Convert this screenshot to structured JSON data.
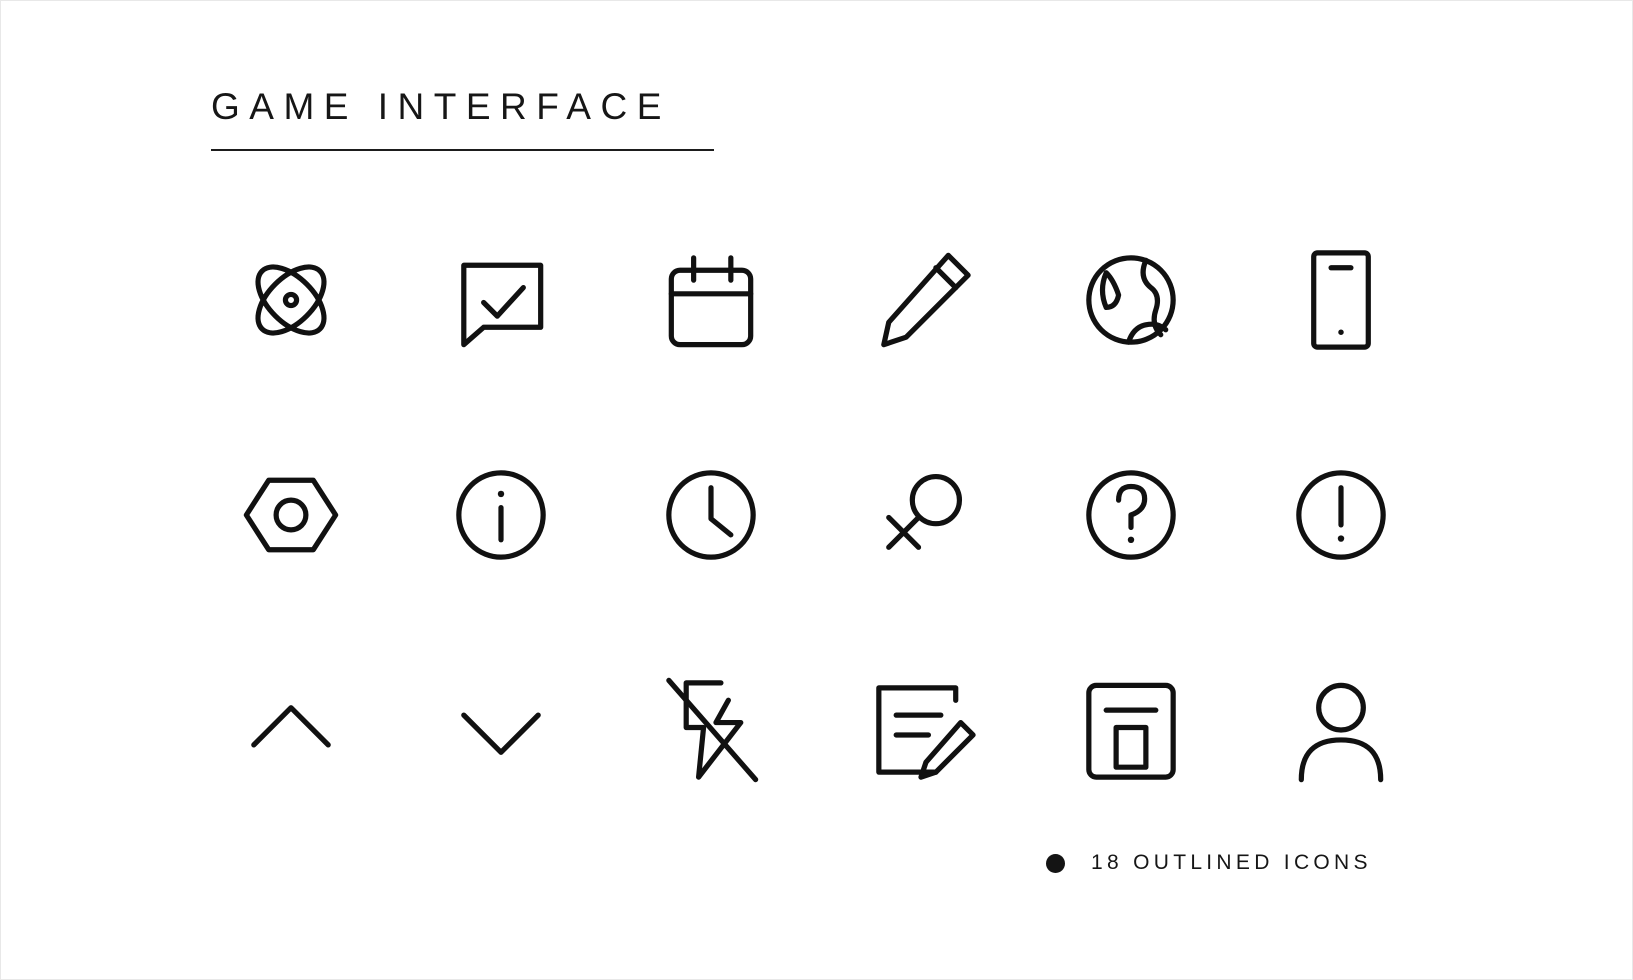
{
  "page": {
    "title": "GAME INTERFACE",
    "background_color": "#ffffff",
    "ink_color": "#111111"
  },
  "footer": {
    "bullet": "bullet-dot",
    "text": "18 OUTLINED ICONS"
  },
  "icon_set": {
    "count": 18,
    "columns": 6,
    "rows": 3,
    "style": "outlined",
    "icons": [
      {
        "name": "atom-icon",
        "label": "Atom"
      },
      {
        "name": "chat-check-icon",
        "label": "Chat Check"
      },
      {
        "name": "calendar-icon",
        "label": "Calendar"
      },
      {
        "name": "pencil-icon",
        "label": "Pencil"
      },
      {
        "name": "globe-icon",
        "label": "Globe"
      },
      {
        "name": "smartphone-icon",
        "label": "Smartphone"
      },
      {
        "name": "hex-nut-icon",
        "label": "Hex Nut"
      },
      {
        "name": "info-circle-icon",
        "label": "Info"
      },
      {
        "name": "clock-icon",
        "label": "Clock"
      },
      {
        "name": "search-cross-icon",
        "label": "Search Cross"
      },
      {
        "name": "question-circle-icon",
        "label": "Question"
      },
      {
        "name": "exclamation-circle-icon",
        "label": "Exclamation"
      },
      {
        "name": "chevron-up-icon",
        "label": "Chevron Up"
      },
      {
        "name": "chevron-down-icon",
        "label": "Chevron Down"
      },
      {
        "name": "flash-off-icon",
        "label": "Flash Off"
      },
      {
        "name": "note-edit-icon",
        "label": "Note Edit"
      },
      {
        "name": "archive-box-icon",
        "label": "Archive Box"
      },
      {
        "name": "user-icon",
        "label": "User"
      }
    ]
  }
}
